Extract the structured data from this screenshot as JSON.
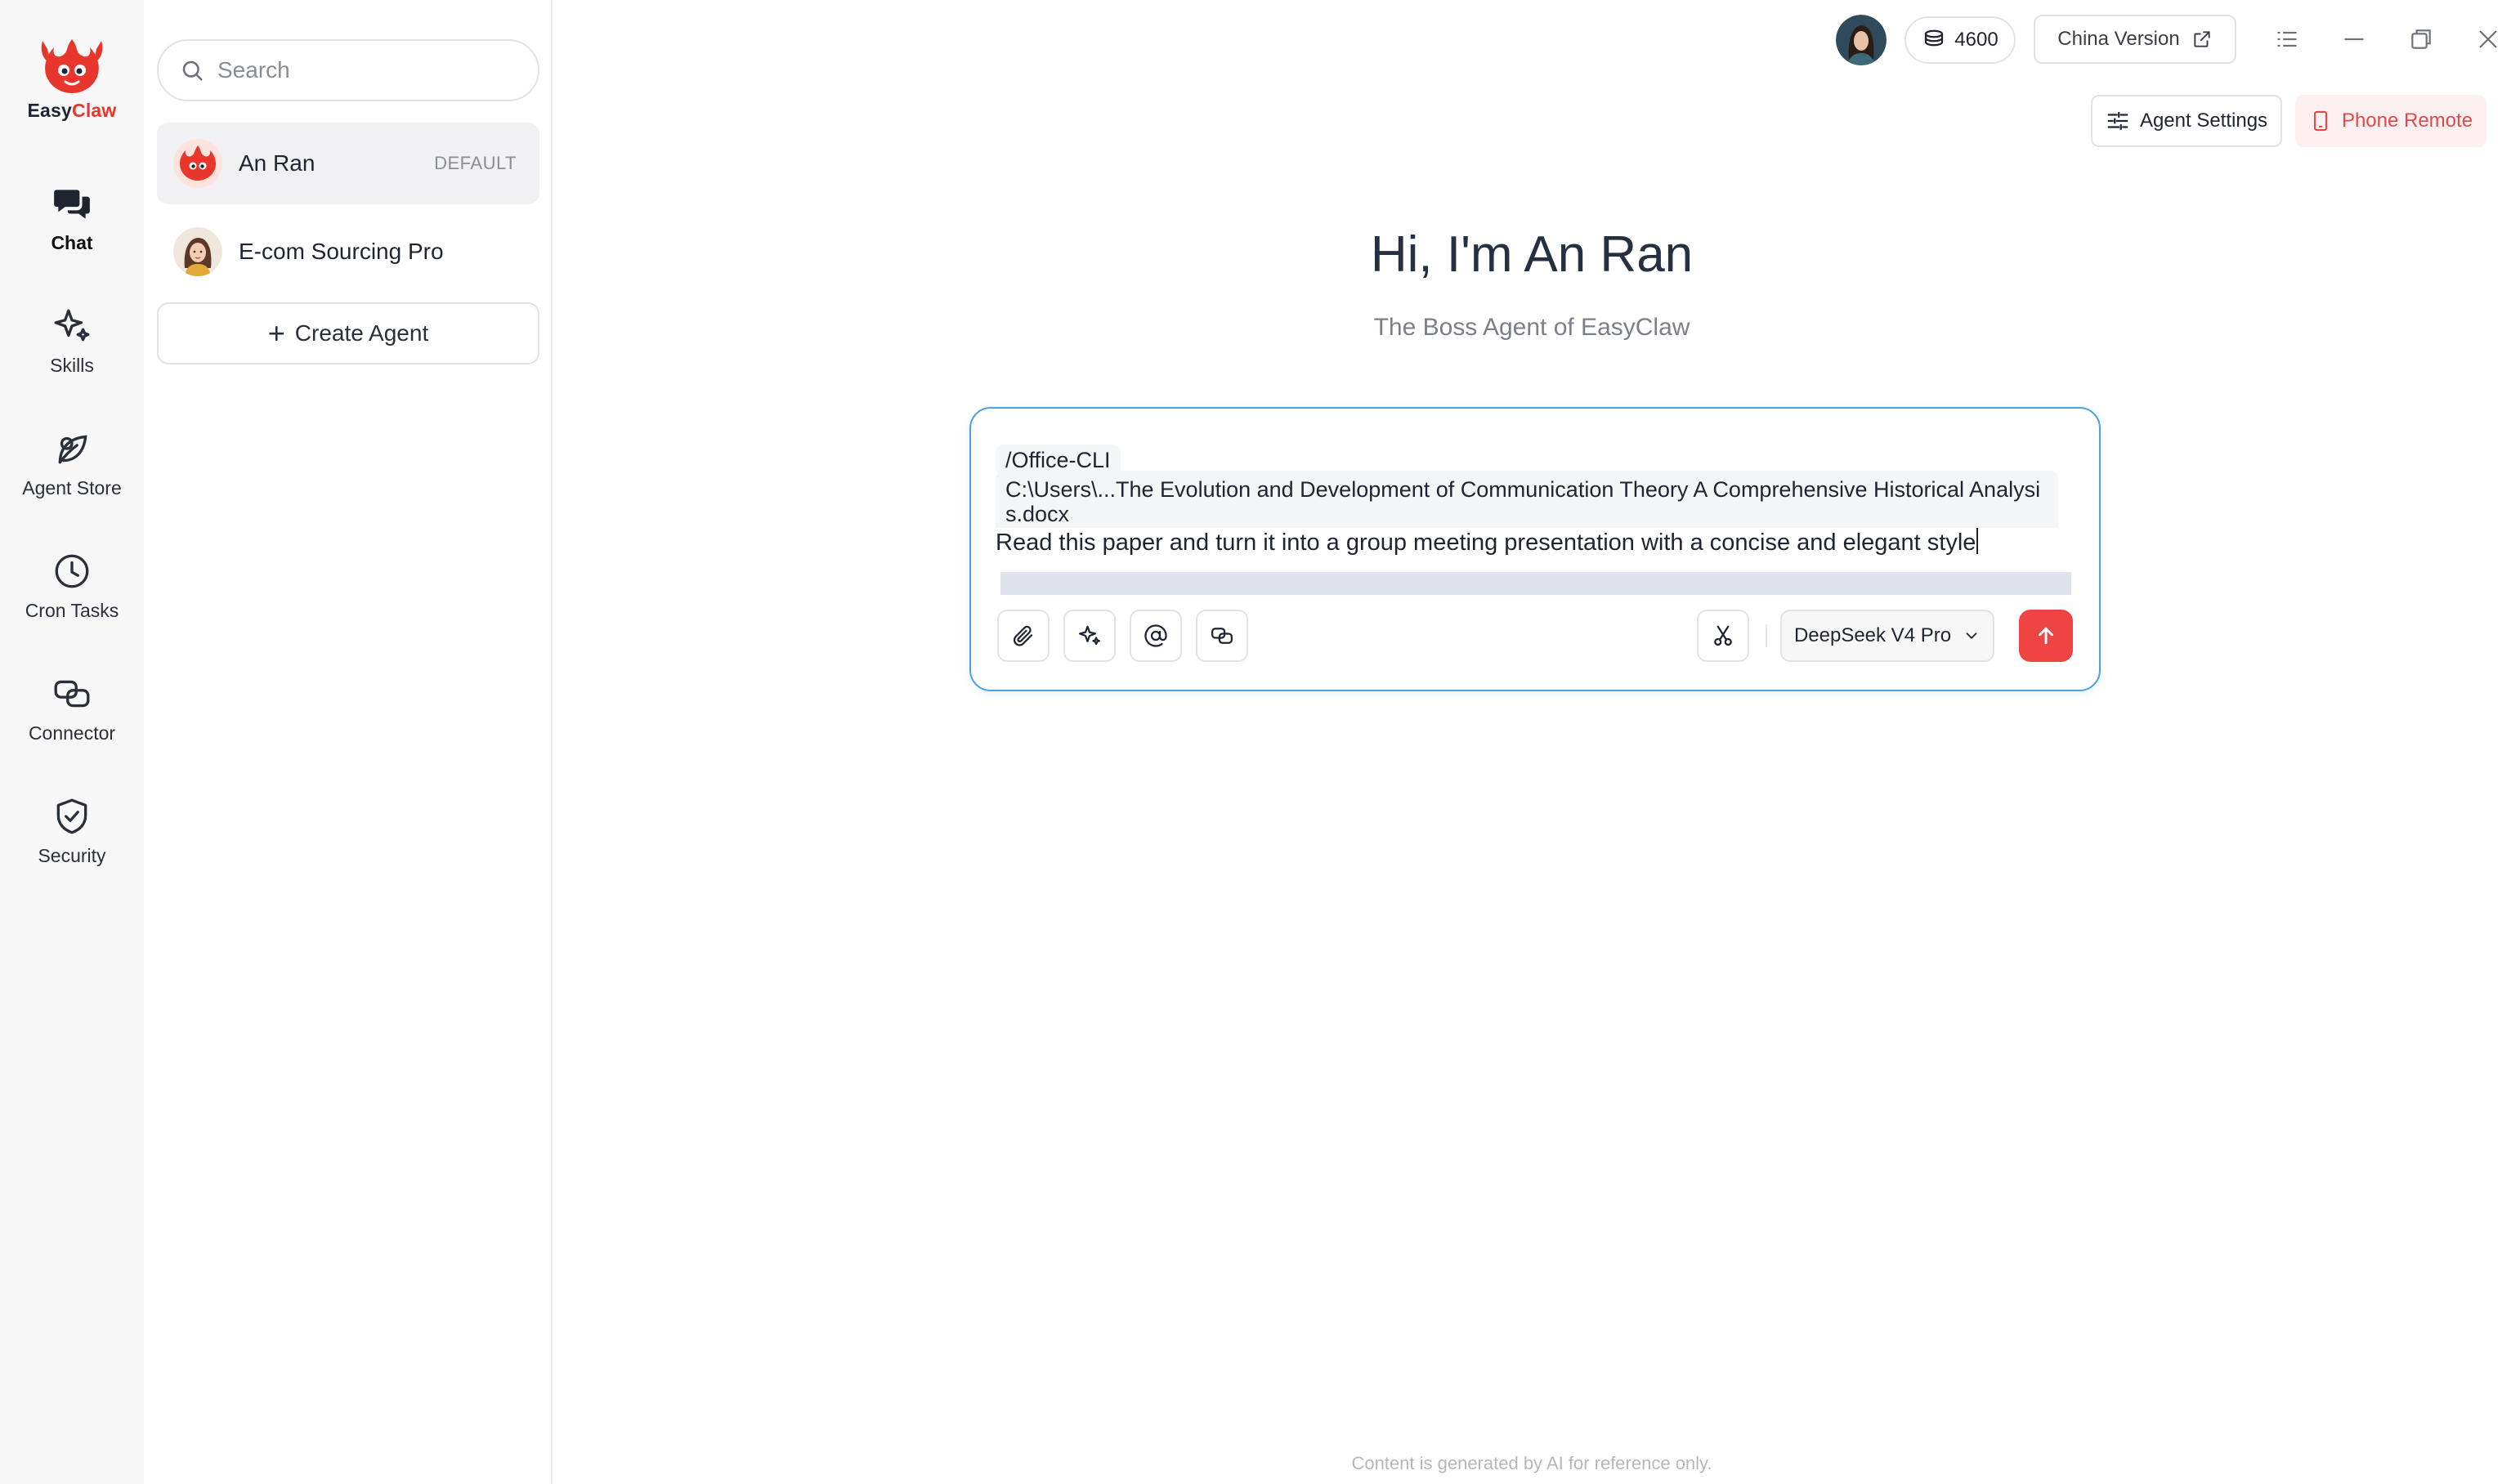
{
  "brand": {
    "name_part1": "Easy",
    "name_part2": "Claw",
    "logo_icon": "crab-flame-logo-icon",
    "accent": "#e8362c"
  },
  "nav": [
    {
      "id": "chat",
      "label": "Chat",
      "icon": "chat-bubbles-icon",
      "active": true
    },
    {
      "id": "skills",
      "label": "Skills",
      "icon": "sparkle-star-icon",
      "active": false
    },
    {
      "id": "agent-store",
      "label": "Agent Store",
      "icon": "leaf-store-icon",
      "active": false
    },
    {
      "id": "cron-tasks",
      "label": "Cron Tasks",
      "icon": "clock-icon",
      "active": false
    },
    {
      "id": "connector",
      "label": "Connector",
      "icon": "link-icon",
      "active": false
    },
    {
      "id": "security",
      "label": "Security",
      "icon": "shield-check-icon",
      "active": false
    }
  ],
  "sidebar": {
    "search_placeholder": "Search",
    "agents": [
      {
        "name": "An Ran",
        "tag": "DEFAULT",
        "active": true
      },
      {
        "name": "E-com Sourcing Pro",
        "tag": "",
        "active": false
      }
    ],
    "create_label": "Create Agent"
  },
  "topbar": {
    "credits": "4600",
    "china_version": "China Version",
    "agent_settings": "Agent Settings",
    "phone_remote": "Phone Remote"
  },
  "hero": {
    "title": "Hi, I'm An Ran",
    "subtitle": "The Boss Agent of EasyClaw"
  },
  "composer": {
    "skill_chip": "/Office-CLI",
    "attachment_path": "C:\\Users\\...The Evolution and Development of Communication Theory A Comprehensive Historical Analysis.docx",
    "prompt_text": "Read this paper and turn it into a group meeting presentation with a concise and elegant style",
    "model": "DeepSeek V4 Pro",
    "tools": [
      "paperclip-icon",
      "sparkle-icon",
      "at-sign-icon",
      "link-icon"
    ]
  },
  "footer": {
    "note": "Content is generated by AI for reference only."
  },
  "colors": {
    "focus_border": "#4aa3df",
    "send_button": "#ee4444",
    "phone_remote_text": "#e24a4a"
  }
}
